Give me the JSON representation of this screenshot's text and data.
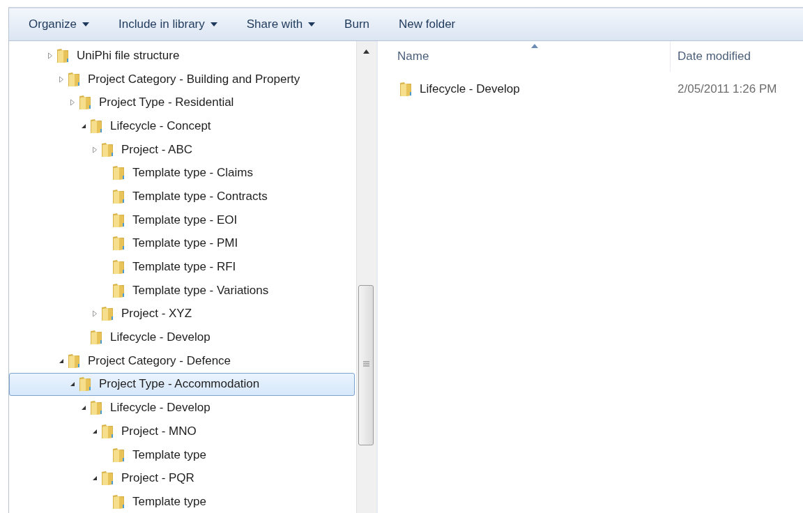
{
  "toolbar": [
    {
      "label": "Organize",
      "dropdown": true
    },
    {
      "label": "Include in library",
      "dropdown": true
    },
    {
      "label": "Share with",
      "dropdown": true
    },
    {
      "label": "Burn",
      "dropdown": false
    },
    {
      "label": "New folder",
      "dropdown": false
    }
  ],
  "tree": [
    {
      "label": "UniPhi file structure",
      "expanded": false,
      "selected": false,
      "children": [
        {
          "label": "Project Category - Building and Property",
          "expanded": false,
          "selected": false,
          "children": [
            {
              "label": "Project Type - Residential",
              "expanded": false,
              "selected": false,
              "children": [
                {
                  "label": "Lifecycle - Concept",
                  "expanded": true,
                  "selected": false,
                  "children": [
                    {
                      "label": "Project - ABC",
                      "expanded": false,
                      "selected": false,
                      "children": [
                        {
                          "label": "Template type - Claims",
                          "selected": false
                        },
                        {
                          "label": "Template type - Contracts",
                          "selected": false
                        },
                        {
                          "label": "Template type - EOI",
                          "selected": false
                        },
                        {
                          "label": "Template type - PMI",
                          "selected": false
                        },
                        {
                          "label": "Template type - RFI",
                          "selected": false
                        },
                        {
                          "label": "Template type - Variations",
                          "selected": false
                        }
                      ]
                    },
                    {
                      "label": "Project - XYZ",
                      "expanded": false,
                      "selected": false
                    }
                  ]
                },
                {
                  "label": "Lifecycle - Develop",
                  "selected": false
                }
              ]
            }
          ]
        },
        {
          "label": "Project Category - Defence",
          "expanded": true,
          "selected": false,
          "children": [
            {
              "label": "Project Type - Accommodation",
              "expanded": true,
              "selected": true,
              "children": [
                {
                  "label": "Lifecycle - Develop",
                  "expanded": true,
                  "selected": false,
                  "children": [
                    {
                      "label": "Project - MNO",
                      "expanded": true,
                      "selected": false,
                      "children": [
                        {
                          "label": "Template type",
                          "selected": false
                        }
                      ]
                    },
                    {
                      "label": "Project - PQR",
                      "expanded": true,
                      "selected": false,
                      "children": [
                        {
                          "label": "Template type",
                          "selected": false
                        }
                      ]
                    }
                  ]
                }
              ]
            }
          ]
        }
      ]
    }
  ],
  "file_list": {
    "columns": [
      "Name",
      "Date modified"
    ],
    "rows": [
      {
        "name": "Lifecycle - Develop",
        "date_modified": "2/05/2011 1:26 PM"
      }
    ]
  }
}
